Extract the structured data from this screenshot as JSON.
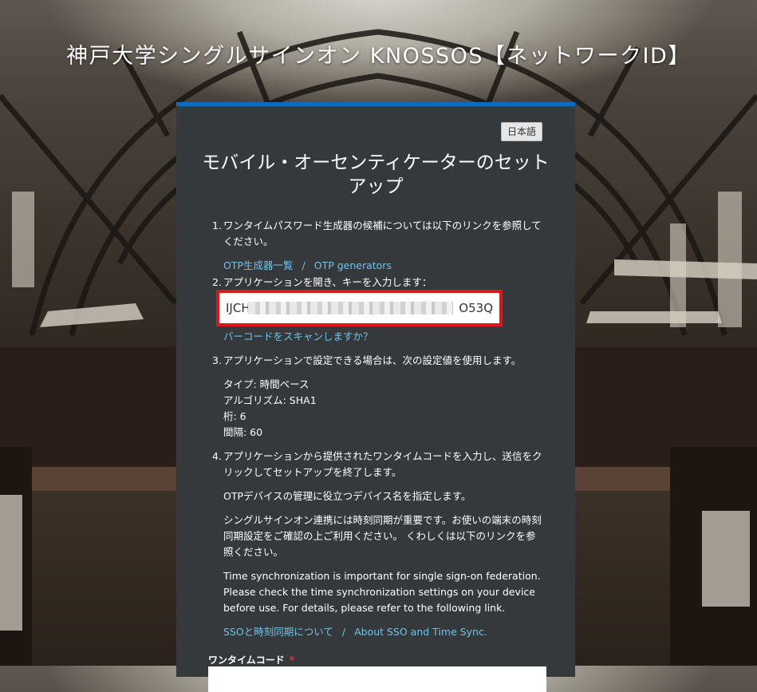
{
  "site": {
    "title": "神戸大学シングルサインオン KNOSSOS【ネットワークID】"
  },
  "lang_button": "日本語",
  "page_title": "モバイル・オーセンティケーターのセットアップ",
  "steps": {
    "s1": {
      "num": "1.",
      "text": "ワンタイムパスワード生成器の候補については以下のリンクを参照してください。",
      "link_ja": "OTP生成器一覧",
      "sep": "/",
      "link_en": "OTP generators"
    },
    "s2": {
      "num": "2.",
      "text": "アプリケーションを開き、キーを入力します：",
      "key_start": "IJCH",
      "key_end": "O53Q",
      "barcode_link": "バーコードをスキャンしますか？"
    },
    "s3": {
      "num": "3.",
      "text": "アプリケーションで設定できる場合は、次の設定値を使用します。",
      "type": "タイプ: 時間ベース",
      "algorithm": "アルゴリズム: SHA1",
      "digits": "桁: 6",
      "period": "間隔: 60"
    },
    "s4": {
      "num": "4.",
      "text": "アプリケーションから提供されたワンタイムコードを入力し、送信をクリックしてセットアップを終了します。",
      "device_name": "OTPデバイスの管理に役立つデバイス名を指定します。",
      "sync_ja": "シングルサインオン連携には時刻同期が重要です。お使いの端末の時刻同期設定をご確認の上ご利用ください。 くわしくは以下のリンクを参照ください。",
      "sync_en": "Time synchronization is important for single sign-on federation. Please check the time synchronization settings on your device before use. For details, please refer to the following link.",
      "link_ja": "SSOと時刻同期について",
      "sep": "/",
      "link_en": "About SSO and Time Sync."
    }
  },
  "otp_field": {
    "label": "ワンタイムコード",
    "required_mark": "*"
  },
  "colors": {
    "card_bg": "#35393c",
    "accent": "#0f6cbd",
    "link": "#6fc3ea",
    "highlight_border": "#d7191f",
    "required": "#e6353b"
  }
}
